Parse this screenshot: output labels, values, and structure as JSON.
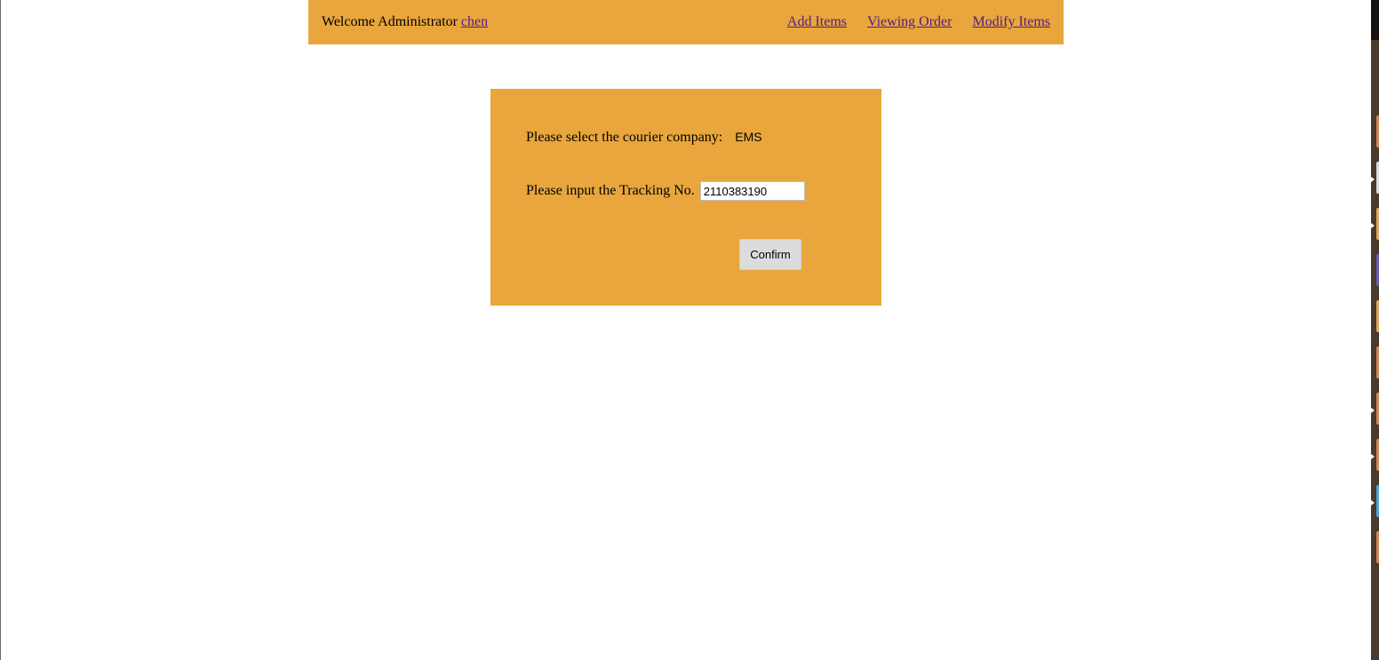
{
  "header": {
    "welcome_text": "Welcome Administrator",
    "username": "chen",
    "nav": {
      "add_items": "Add Items",
      "viewing_order": "Viewing Order",
      "modify_items": "Modify Items"
    }
  },
  "form": {
    "courier_label": "Please select the courier company:",
    "courier_value": "EMS",
    "tracking_label": "Please input the Tracking No.",
    "tracking_value": "2110383190",
    "confirm_label": "Confirm"
  },
  "colors": {
    "accent": "#e8a63c",
    "link": "#551a8b",
    "button_bg": "#dcdcdc"
  }
}
